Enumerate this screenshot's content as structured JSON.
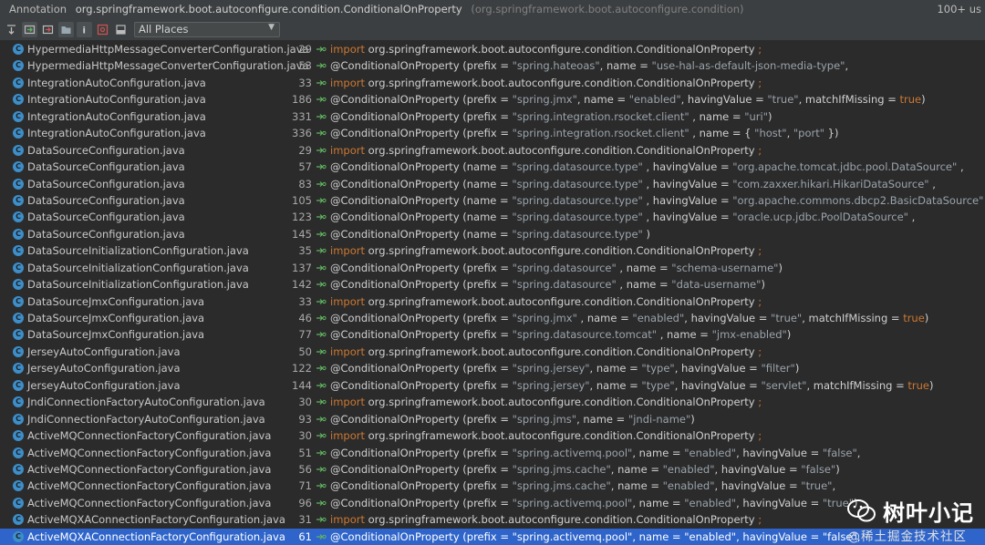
{
  "titlebar": {
    "label": "Annotation",
    "annotation": "org.springframework.boot.autoconfigure.condition.ConditionalOnProperty",
    "package": "(org.springframework.boot.autoconfigure.condition)",
    "count": "100+ us"
  },
  "toolbar": {
    "scope_value": "All Places",
    "icons": [
      "expand-icon",
      "group-by-module-icon",
      "group-by-directory-icon",
      "group-by-package-icon",
      "preview-info-icon",
      "filter-icon",
      "settings-icon"
    ]
  },
  "colors": {
    "background": "#2b2b2b",
    "keyword": "#cc7832",
    "selection": "#2f65ca",
    "class_icon": "#3d8ec9"
  },
  "watermark": {
    "title": "树叶小记",
    "subtitle": "@稀土掘金技术社区"
  },
  "rows": [
    {
      "file": "HypermediaHttpMessageConverterConfiguration.java",
      "line": "29",
      "segments": [
        {
          "t": "import",
          "k": "kw"
        },
        {
          "t": " org.springframework.boot.autoconfigure.condition.ConditionalOnProperty ",
          "k": "code"
        },
        {
          "t": ";",
          "k": "kw"
        }
      ]
    },
    {
      "file": "HypermediaHttpMessageConverterConfiguration.java",
      "line": "53",
      "segments": [
        {
          "t": "@ConditionalOnProperty (prefix = ",
          "k": "code"
        },
        {
          "t": "\"spring.hateoas\"",
          "k": "str"
        },
        {
          "t": ", name = ",
          "k": "code"
        },
        {
          "t": "\"use-hal-as-default-json-media-type\"",
          "k": "str"
        },
        {
          "t": ",",
          "k": "code"
        }
      ]
    },
    {
      "file": "IntegrationAutoConfiguration.java",
      "line": "33",
      "segments": [
        {
          "t": "import",
          "k": "kw"
        },
        {
          "t": " org.springframework.boot.autoconfigure.condition.ConditionalOnProperty ",
          "k": "code"
        },
        {
          "t": ";",
          "k": "kw"
        }
      ]
    },
    {
      "file": "IntegrationAutoConfiguration.java",
      "line": "186",
      "segments": [
        {
          "t": "@ConditionalOnProperty (prefix = ",
          "k": "code"
        },
        {
          "t": "\"spring.jmx\"",
          "k": "str"
        },
        {
          "t": ", name = ",
          "k": "code"
        },
        {
          "t": "\"enabled\"",
          "k": "str"
        },
        {
          "t": ", havingValue = ",
          "k": "code"
        },
        {
          "t": "\"true\"",
          "k": "str"
        },
        {
          "t": ", matchIfMissing = ",
          "k": "code"
        },
        {
          "t": "true",
          "k": "kw"
        },
        {
          "t": ")",
          "k": "code"
        }
      ]
    },
    {
      "file": "IntegrationAutoConfiguration.java",
      "line": "331",
      "segments": [
        {
          "t": "@ConditionalOnProperty (prefix = ",
          "k": "code"
        },
        {
          "t": "\"spring.integration.rsocket.client\"",
          "k": "str"
        },
        {
          "t": " , name = ",
          "k": "code"
        },
        {
          "t": "\"uri\"",
          "k": "str"
        },
        {
          "t": ")",
          "k": "code"
        }
      ]
    },
    {
      "file": "IntegrationAutoConfiguration.java",
      "line": "336",
      "segments": [
        {
          "t": "@ConditionalOnProperty (prefix = ",
          "k": "code"
        },
        {
          "t": "\"spring.integration.rsocket.client\"",
          "k": "str"
        },
        {
          "t": " , name = { ",
          "k": "code"
        },
        {
          "t": "\"host\"",
          "k": "str"
        },
        {
          "t": ", ",
          "k": "code"
        },
        {
          "t": "\"port\"",
          "k": "str"
        },
        {
          "t": " })",
          "k": "code"
        }
      ]
    },
    {
      "file": "DataSourceConfiguration.java",
      "line": "29",
      "segments": [
        {
          "t": "import",
          "k": "kw"
        },
        {
          "t": " org.springframework.boot.autoconfigure.condition.ConditionalOnProperty ",
          "k": "code"
        },
        {
          "t": ";",
          "k": "kw"
        }
      ]
    },
    {
      "file": "DataSourceConfiguration.java",
      "line": "57",
      "segments": [
        {
          "t": "@ConditionalOnProperty (name = ",
          "k": "code"
        },
        {
          "t": "\"spring.datasource.type\"",
          "k": "str"
        },
        {
          "t": " , havingValue = ",
          "k": "code"
        },
        {
          "t": "\"org.apache.tomcat.jdbc.pool.DataSource\"",
          "k": "str"
        },
        {
          "t": " ,",
          "k": "code"
        }
      ]
    },
    {
      "file": "DataSourceConfiguration.java",
      "line": "83",
      "segments": [
        {
          "t": "@ConditionalOnProperty (name = ",
          "k": "code"
        },
        {
          "t": "\"spring.datasource.type\"",
          "k": "str"
        },
        {
          "t": " , havingValue = ",
          "k": "code"
        },
        {
          "t": "\"com.zaxxer.hikari.HikariDataSource\"",
          "k": "str"
        },
        {
          "t": " ,",
          "k": "code"
        }
      ]
    },
    {
      "file": "DataSourceConfiguration.java",
      "line": "105",
      "segments": [
        {
          "t": "@ConditionalOnProperty (name = ",
          "k": "code"
        },
        {
          "t": "\"spring.datasource.type\"",
          "k": "str"
        },
        {
          "t": " , havingValue = ",
          "k": "code"
        },
        {
          "t": "\"org.apache.commons.dbcp2.BasicDataSource\"",
          "k": "str"
        },
        {
          "t": " ,",
          "k": "code"
        }
      ]
    },
    {
      "file": "DataSourceConfiguration.java",
      "line": "123",
      "segments": [
        {
          "t": "@ConditionalOnProperty (name = ",
          "k": "code"
        },
        {
          "t": "\"spring.datasource.type\"",
          "k": "str"
        },
        {
          "t": " , havingValue = ",
          "k": "code"
        },
        {
          "t": "\"oracle.ucp.jdbc.PoolDataSource\"",
          "k": "str"
        },
        {
          "t": " ,",
          "k": "code"
        }
      ]
    },
    {
      "file": "DataSourceConfiguration.java",
      "line": "145",
      "segments": [
        {
          "t": "@ConditionalOnProperty (name = ",
          "k": "code"
        },
        {
          "t": "\"spring.datasource.type\"",
          "k": "str"
        },
        {
          "t": " )",
          "k": "code"
        }
      ]
    },
    {
      "file": "DataSourceInitializationConfiguration.java",
      "line": "35",
      "segments": [
        {
          "t": "import",
          "k": "kw"
        },
        {
          "t": " org.springframework.boot.autoconfigure.condition.ConditionalOnProperty ",
          "k": "code"
        },
        {
          "t": ";",
          "k": "kw"
        }
      ]
    },
    {
      "file": "DataSourceInitializationConfiguration.java",
      "line": "137",
      "segments": [
        {
          "t": "@ConditionalOnProperty (prefix = ",
          "k": "code"
        },
        {
          "t": "\"spring.datasource\"",
          "k": "str"
        },
        {
          "t": " , name = ",
          "k": "code"
        },
        {
          "t": "\"schema-username\"",
          "k": "str"
        },
        {
          "t": ")",
          "k": "code"
        }
      ]
    },
    {
      "file": "DataSourceInitializationConfiguration.java",
      "line": "142",
      "segments": [
        {
          "t": "@ConditionalOnProperty (prefix = ",
          "k": "code"
        },
        {
          "t": "\"spring.datasource\"",
          "k": "str"
        },
        {
          "t": " , name = ",
          "k": "code"
        },
        {
          "t": "\"data-username\"",
          "k": "str"
        },
        {
          "t": ")",
          "k": "code"
        }
      ]
    },
    {
      "file": "DataSourceJmxConfiguration.java",
      "line": "33",
      "segments": [
        {
          "t": "import",
          "k": "kw"
        },
        {
          "t": " org.springframework.boot.autoconfigure.condition.ConditionalOnProperty ",
          "k": "code"
        },
        {
          "t": ";",
          "k": "kw"
        }
      ]
    },
    {
      "file": "DataSourceJmxConfiguration.java",
      "line": "46",
      "segments": [
        {
          "t": "@ConditionalOnProperty (prefix = ",
          "k": "code"
        },
        {
          "t": "\"spring.jmx\"",
          "k": "str"
        },
        {
          "t": " , name = ",
          "k": "code"
        },
        {
          "t": "\"enabled\"",
          "k": "str"
        },
        {
          "t": ", havingValue = ",
          "k": "code"
        },
        {
          "t": "\"true\"",
          "k": "str"
        },
        {
          "t": ", matchIfMissing = ",
          "k": "code"
        },
        {
          "t": "true",
          "k": "kw"
        },
        {
          "t": ")",
          "k": "code"
        }
      ]
    },
    {
      "file": "DataSourceJmxConfiguration.java",
      "line": "77",
      "segments": [
        {
          "t": "@ConditionalOnProperty (prefix = ",
          "k": "code"
        },
        {
          "t": "\"spring.datasource.tomcat\"",
          "k": "str"
        },
        {
          "t": " , name = ",
          "k": "code"
        },
        {
          "t": "\"jmx-enabled\"",
          "k": "str"
        },
        {
          "t": ")",
          "k": "code"
        }
      ]
    },
    {
      "file": "JerseyAutoConfiguration.java",
      "line": "50",
      "segments": [
        {
          "t": "import",
          "k": "kw"
        },
        {
          "t": " org.springframework.boot.autoconfigure.condition.ConditionalOnProperty ",
          "k": "code"
        },
        {
          "t": ";",
          "k": "kw"
        }
      ]
    },
    {
      "file": "JerseyAutoConfiguration.java",
      "line": "122",
      "segments": [
        {
          "t": "@ConditionalOnProperty (prefix = ",
          "k": "code"
        },
        {
          "t": "\"spring.jersey\"",
          "k": "str"
        },
        {
          "t": ", name = ",
          "k": "code"
        },
        {
          "t": "\"type\"",
          "k": "str"
        },
        {
          "t": ", havingValue = ",
          "k": "code"
        },
        {
          "t": "\"filter\"",
          "k": "str"
        },
        {
          "t": ")",
          "k": "code"
        }
      ]
    },
    {
      "file": "JerseyAutoConfiguration.java",
      "line": "144",
      "segments": [
        {
          "t": "@ConditionalOnProperty (prefix = ",
          "k": "code"
        },
        {
          "t": "\"spring.jersey\"",
          "k": "str"
        },
        {
          "t": ", name = ",
          "k": "code"
        },
        {
          "t": "\"type\"",
          "k": "str"
        },
        {
          "t": ", havingValue = ",
          "k": "code"
        },
        {
          "t": "\"servlet\"",
          "k": "str"
        },
        {
          "t": ", matchIfMissing = ",
          "k": "code"
        },
        {
          "t": "true",
          "k": "kw"
        },
        {
          "t": ")",
          "k": "code"
        }
      ]
    },
    {
      "file": "JndiConnectionFactoryAutoConfiguration.java",
      "line": "30",
      "segments": [
        {
          "t": "import",
          "k": "kw"
        },
        {
          "t": " org.springframework.boot.autoconfigure.condition.ConditionalOnProperty ",
          "k": "code"
        },
        {
          "t": ";",
          "k": "kw"
        }
      ]
    },
    {
      "file": "JndiConnectionFactoryAutoConfiguration.java",
      "line": "93",
      "segments": [
        {
          "t": "@ConditionalOnProperty (prefix = ",
          "k": "code"
        },
        {
          "t": "\"spring.jms\"",
          "k": "str"
        },
        {
          "t": ", name = ",
          "k": "code"
        },
        {
          "t": "\"jndi-name\"",
          "k": "str"
        },
        {
          "t": ")",
          "k": "code"
        }
      ]
    },
    {
      "file": "ActiveMQConnectionFactoryConfiguration.java",
      "line": "30",
      "segments": [
        {
          "t": "import",
          "k": "kw"
        },
        {
          "t": " org.springframework.boot.autoconfigure.condition.ConditionalOnProperty ",
          "k": "code"
        },
        {
          "t": ";",
          "k": "kw"
        }
      ]
    },
    {
      "file": "ActiveMQConnectionFactoryConfiguration.java",
      "line": "51",
      "segments": [
        {
          "t": "@ConditionalOnProperty (prefix = ",
          "k": "code"
        },
        {
          "t": "\"spring.activemq.pool\"",
          "k": "str"
        },
        {
          "t": ", name = ",
          "k": "code"
        },
        {
          "t": "\"enabled\"",
          "k": "str"
        },
        {
          "t": ", havingValue = ",
          "k": "code"
        },
        {
          "t": "\"false\"",
          "k": "str"
        },
        {
          "t": ",",
          "k": "code"
        }
      ]
    },
    {
      "file": "ActiveMQConnectionFactoryConfiguration.java",
      "line": "56",
      "segments": [
        {
          "t": "@ConditionalOnProperty (prefix = ",
          "k": "code"
        },
        {
          "t": "\"spring.jms.cache\"",
          "k": "str"
        },
        {
          "t": ", name = ",
          "k": "code"
        },
        {
          "t": "\"enabled\"",
          "k": "str"
        },
        {
          "t": ", havingValue = ",
          "k": "code"
        },
        {
          "t": "\"false\"",
          "k": "str"
        },
        {
          "t": ")",
          "k": "code"
        }
      ]
    },
    {
      "file": "ActiveMQConnectionFactoryConfiguration.java",
      "line": "71",
      "segments": [
        {
          "t": "@ConditionalOnProperty (prefix = ",
          "k": "code"
        },
        {
          "t": "\"spring.jms.cache\"",
          "k": "str"
        },
        {
          "t": ", name = ",
          "k": "code"
        },
        {
          "t": "\"enabled\"",
          "k": "str"
        },
        {
          "t": ", havingValue = ",
          "k": "code"
        },
        {
          "t": "\"true\"",
          "k": "str"
        },
        {
          "t": ",",
          "k": "code"
        }
      ]
    },
    {
      "file": "ActiveMQConnectionFactoryConfiguration.java",
      "line": "96",
      "segments": [
        {
          "t": "@ConditionalOnProperty (prefix = ",
          "k": "code"
        },
        {
          "t": "\"spring.activemq.pool\"",
          "k": "str"
        },
        {
          "t": ", name = ",
          "k": "code"
        },
        {
          "t": "\"enabled\"",
          "k": "str"
        },
        {
          "t": ", havingValue = ",
          "k": "code"
        },
        {
          "t": "\"true\"",
          "k": "str"
        },
        {
          "t": ")",
          "k": "code"
        }
      ]
    },
    {
      "file": "ActiveMQXAConnectionFactoryConfiguration.java",
      "line": "31",
      "segments": [
        {
          "t": "import",
          "k": "kw"
        },
        {
          "t": " org.springframework.boot.autoconfigure.condition.ConditionalOnProperty ",
          "k": "code"
        },
        {
          "t": ";",
          "k": "kw"
        }
      ]
    },
    {
      "file": "ActiveMQXAConnectionFactoryConfiguration.java",
      "line": "61",
      "selected": true,
      "segments": [
        {
          "t": "@ConditionalOnProperty (prefix = ",
          "k": "code"
        },
        {
          "t": "\"spring.activemq.pool\"",
          "k": "str"
        },
        {
          "t": ", name = ",
          "k": "code"
        },
        {
          "t": "\"enabled\"",
          "k": "str"
        },
        {
          "t": ", havingValue = ",
          "k": "code"
        },
        {
          "t": "\"false\"",
          "k": "str"
        },
        {
          "t": ",",
          "k": "code"
        }
      ]
    }
  ]
}
